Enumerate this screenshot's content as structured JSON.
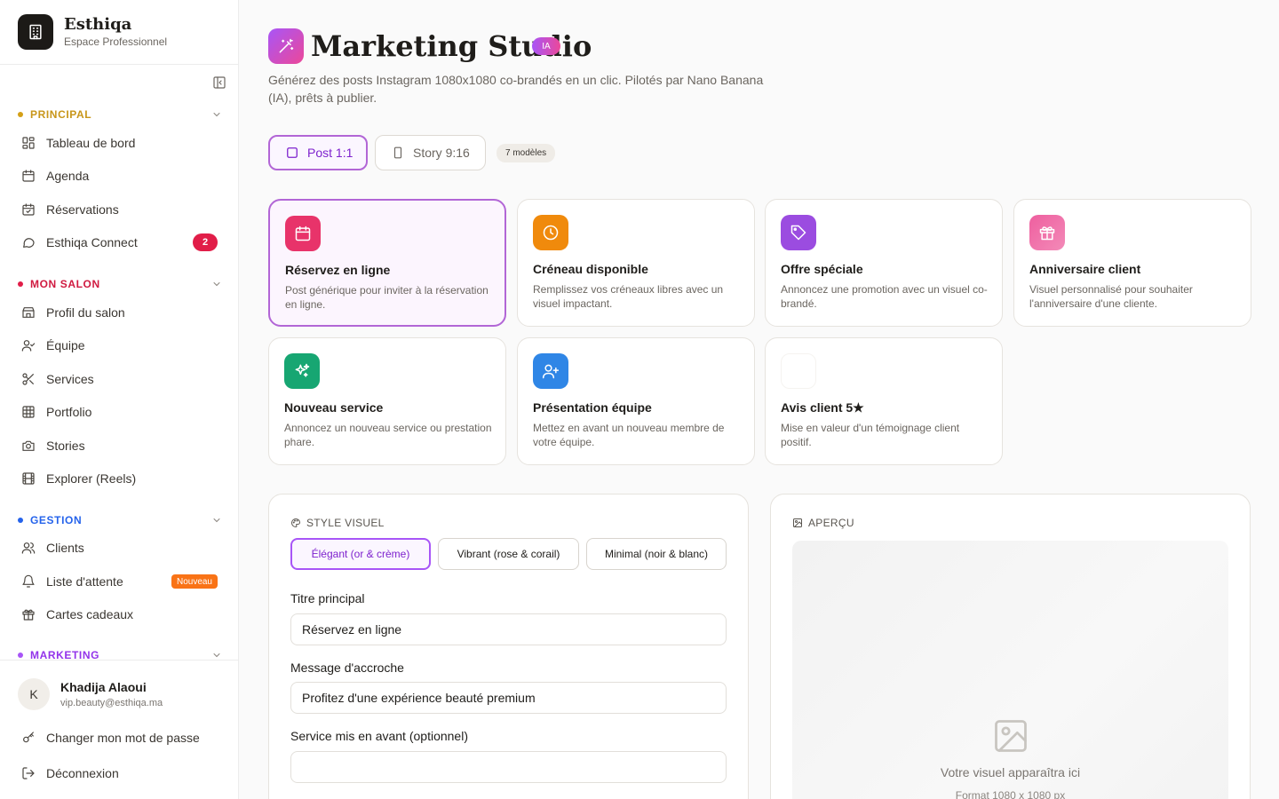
{
  "brand": {
    "name": "Esthiqa",
    "subtitle": "Espace Professionnel"
  },
  "sidebar": {
    "sections": [
      {
        "title": "PRINCIPAL",
        "color": "#d4a017"
      },
      {
        "title": "MON SALON",
        "color": "#e11d48"
      },
      {
        "title": "GESTION",
        "color": "#2563eb"
      },
      {
        "title": "MARKETING",
        "color": "#a855f7"
      }
    ],
    "principal": [
      {
        "label": "Tableau de bord",
        "icon": "dashboard-icon"
      },
      {
        "label": "Agenda",
        "icon": "calendar-icon"
      },
      {
        "label": "Réservations",
        "icon": "calendar-check-icon"
      },
      {
        "label": "Esthiqa Connect",
        "icon": "chat-icon",
        "badge": "2"
      }
    ],
    "mon_salon": [
      {
        "label": "Profil du salon",
        "icon": "store-icon"
      },
      {
        "label": "Équipe",
        "icon": "team-icon"
      },
      {
        "label": "Services",
        "icon": "scissors-icon"
      },
      {
        "label": "Portfolio",
        "icon": "grid-icon"
      },
      {
        "label": "Stories",
        "icon": "camera-icon"
      },
      {
        "label": "Explorer (Reels)",
        "icon": "film-icon"
      }
    ],
    "gestion": [
      {
        "label": "Clients",
        "icon": "users-icon"
      },
      {
        "label": "Liste d'attente",
        "icon": "bell-icon",
        "tag": "Nouveau"
      },
      {
        "label": "Cartes cadeaux",
        "icon": "gift-icon"
      }
    ]
  },
  "user": {
    "initial": "K",
    "name": "Khadija Alaoui",
    "email": "vip.beauty@esthiqa.ma",
    "change_password": "Changer mon mot de passe",
    "logout": "Déconnexion"
  },
  "page": {
    "title": "Marketing Studio",
    "badge": "IA",
    "subtitle": "Générez des posts Instagram 1080x1080 co-brandés en un clic. Pilotés par Nano Banana (IA), prêts à publier."
  },
  "formats": {
    "post_label": "Post 1:1",
    "story_label": "Story 9:16",
    "models_count": "7 modèles",
    "selected": "post"
  },
  "templates": [
    {
      "title": "Réservez en ligne",
      "desc": "Post générique pour inviter à la réservation en ligne.",
      "icon": "calendar-icon",
      "color": "#e8336a",
      "selected": true
    },
    {
      "title": "Créneau disponible",
      "desc": "Remplissez vos créneaux libres avec un visuel impactant.",
      "icon": "clock-icon",
      "color": "#f08a0c"
    },
    {
      "title": "Offre spéciale",
      "desc": "Annoncez une promotion avec un visuel co-brandé.",
      "icon": "tag-icon",
      "color": "#9b4ce0"
    },
    {
      "title": "Anniversaire client",
      "desc": "Visuel personnalisé pour souhaiter l'anniversaire d'une cliente.",
      "icon": "gift-icon",
      "color": "#ee5f9f"
    },
    {
      "title": "Nouveau service",
      "desc": "Annoncez un nouveau service ou prestation phare.",
      "icon": "sparkles-icon",
      "color": "#17a672"
    },
    {
      "title": "Présentation équipe",
      "desc": "Mettez en avant un nouveau membre de votre équipe.",
      "icon": "user-plus-icon",
      "color": "#2f86e6"
    },
    {
      "title": "Avis client 5★",
      "desc": "Mise en valeur d'un témoignage client positif.",
      "icon": "star-icon",
      "color": "#ffffff"
    }
  ],
  "style_panel": {
    "heading": "STYLE VISUEL",
    "options": [
      "Élégant (or & crème)",
      "Vibrant (rose & corail)",
      "Minimal (noir & blanc)"
    ],
    "selected": "Élégant (or & crème)",
    "fields": {
      "title_label": "Titre principal",
      "title_value": "Réservez en ligne",
      "hook_label": "Message d'accroche",
      "hook_value": "Profitez d'une expérience beauté premium",
      "service_label": "Service mis en avant (optionnel)",
      "service_value": ""
    }
  },
  "preview_panel": {
    "heading": "APERÇU",
    "placeholder": "Votre visuel apparaîtra ici",
    "format": "Format 1080 x 1080 px"
  },
  "colors": {
    "accent": "#a855f7",
    "accent_pink": "#ec4899",
    "danger": "#e11d48",
    "orange": "#f97316"
  }
}
